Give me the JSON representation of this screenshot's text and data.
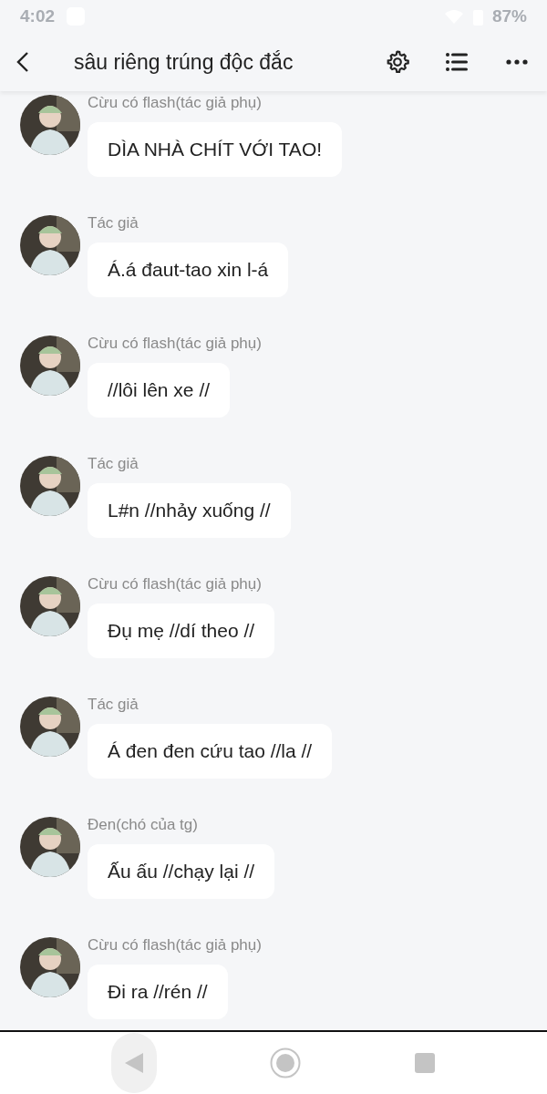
{
  "status_bar": {
    "time": "4:02",
    "battery": "87%"
  },
  "header": {
    "title": "sâu riêng trúng độc đắc"
  },
  "messages": [
    {
      "author": "Cừu có flash(tác giả phụ)",
      "text": "DÌA NHÀ CHÍT VỚI TAO!"
    },
    {
      "author": "Tác giả",
      "text": "Á.á đaut-tao xin l-á"
    },
    {
      "author": "Cừu có flash(tác giả phụ)",
      "text": "//lôi lên xe //"
    },
    {
      "author": "Tác giả",
      "text": "L#n //nhảy xuống //"
    },
    {
      "author": "Cừu có flash(tác giả phụ)",
      "text": "Đụ mẹ //dí theo //"
    },
    {
      "author": "Tác giả",
      "text": "Á đen đen cứu tao //la //"
    },
    {
      "author": "Đen(chó của tg)",
      "text": "Ấu ấu //chạy lại //"
    },
    {
      "author": "Cừu có flash(tác giả phụ)",
      "text": "Đi ra //rén //"
    }
  ]
}
